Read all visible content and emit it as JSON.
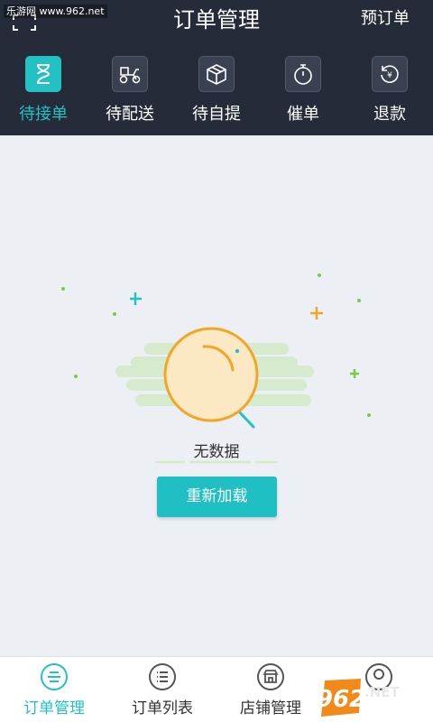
{
  "watermark": "乐游网 www.962.net",
  "header": {
    "title": "订单管理",
    "action_label": "预订单"
  },
  "tabs": [
    {
      "label": "待接单",
      "icon": "hourglass-icon",
      "active": true
    },
    {
      "label": "待配送",
      "icon": "scooter-icon",
      "active": false
    },
    {
      "label": "待自提",
      "icon": "package-icon",
      "active": false
    },
    {
      "label": "催单",
      "icon": "stopwatch-icon",
      "active": false
    },
    {
      "label": "退款",
      "icon": "refund-icon",
      "active": false
    }
  ],
  "empty_state": {
    "message": "无数据",
    "reload_label": "重新加载"
  },
  "bottom_nav": [
    {
      "label": "订单管理",
      "icon": "order-list-icon",
      "active": true
    },
    {
      "label": "订单列表",
      "icon": "list-icon",
      "active": false
    },
    {
      "label": "店铺管理",
      "icon": "store-icon",
      "active": false
    },
    {
      "label": "",
      "icon": "profile-icon",
      "active": false
    }
  ],
  "logo": {
    "text": "962",
    "suffix": ".NET",
    "tagline": "乐游网"
  },
  "colors": {
    "accent": "#22c1c3",
    "header_bg": "#252b38",
    "page_bg": "#eceff4"
  }
}
